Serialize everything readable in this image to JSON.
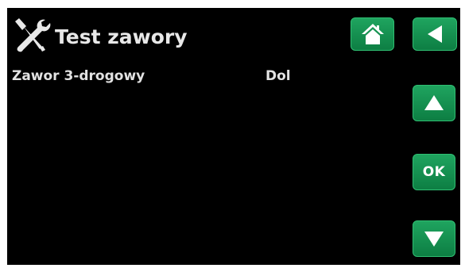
{
  "header": {
    "title": "Test zawory",
    "icon": "tools-icon"
  },
  "rows": [
    {
      "label": "Zawor 3-drogowy",
      "value": "Dol"
    }
  ],
  "buttons": {
    "home_icon": "home-icon",
    "back_icon": "back-arrow-icon",
    "up_icon": "up-arrow-icon",
    "ok_label": "OK",
    "down_icon": "down-arrow-icon"
  },
  "colors": {
    "background": "#000000",
    "button_green": "#16935a",
    "text": "#e6e6e6"
  }
}
